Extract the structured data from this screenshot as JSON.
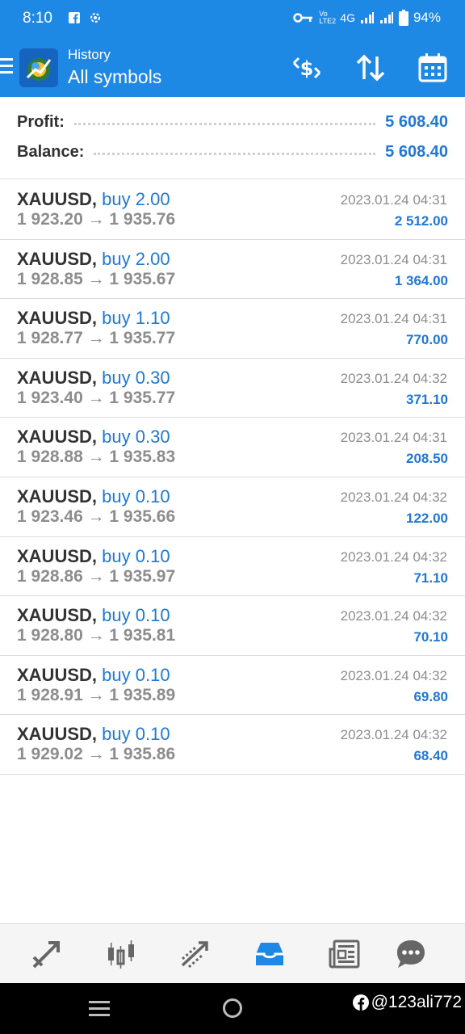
{
  "status_bar": {
    "time": "8:10",
    "network": "4G",
    "battery": "94%"
  },
  "app_bar": {
    "subtitle": "History",
    "title": "All symbols"
  },
  "summary": {
    "profit_label": "Profit:",
    "profit_value": "5 608.40",
    "balance_label": "Balance:",
    "balance_value": "5 608.40"
  },
  "deals": [
    {
      "symbol": "XAUUSD",
      "separator": ",",
      "side": "buy 2.00",
      "prices": "1 923.20 → 1 935.76",
      "date": "2023.01.24 04:31",
      "profit": "2 512.00"
    },
    {
      "symbol": "XAUUSD",
      "separator": ",",
      "side": "buy 2.00",
      "prices": "1 928.85 → 1 935.67",
      "date": "2023.01.24 04:31",
      "profit": "1 364.00"
    },
    {
      "symbol": "XAUUSD",
      "separator": ",",
      "side": "buy 1.10",
      "prices": "1 928.77 → 1 935.77",
      "date": "2023.01.24 04:31",
      "profit": "770.00"
    },
    {
      "symbol": "XAUUSD",
      "separator": ",",
      "side": "buy 0.30",
      "prices": "1 923.40 → 1 935.77",
      "date": "2023.01.24 04:32",
      "profit": "371.10"
    },
    {
      "symbol": "XAUUSD",
      "separator": ",",
      "side": "buy 0.30",
      "prices": "1 928.88 → 1 935.83",
      "date": "2023.01.24 04:31",
      "profit": "208.50"
    },
    {
      "symbol": "XAUUSD",
      "separator": ",",
      "side": "buy 0.10",
      "prices": "1 923.46 → 1 935.66",
      "date": "2023.01.24 04:32",
      "profit": "122.00"
    },
    {
      "symbol": "XAUUSD",
      "separator": ",",
      "side": "buy 0.10",
      "prices": "1 928.86 → 1 935.97",
      "date": "2023.01.24 04:32",
      "profit": "71.10"
    },
    {
      "symbol": "XAUUSD",
      "separator": ",",
      "side": "buy 0.10",
      "prices": "1 928.80 → 1 935.81",
      "date": "2023.01.24 04:32",
      "profit": "70.10"
    },
    {
      "symbol": "XAUUSD",
      "separator": ",",
      "side": "buy 0.10",
      "prices": "1 928.91 → 1 935.89",
      "date": "2023.01.24 04:32",
      "profit": "69.80"
    },
    {
      "symbol": "XAUUSD",
      "separator": ",",
      "side": "buy 0.10",
      "prices": "1 929.02 → 1 935.86",
      "date": "2023.01.24 04:32",
      "profit": "68.40"
    }
  ],
  "tabs": [
    {
      "icon": "quotes-icon",
      "active": false
    },
    {
      "icon": "chart-icon",
      "active": false
    },
    {
      "icon": "trade-icon",
      "active": false
    },
    {
      "icon": "history-icon",
      "active": true
    },
    {
      "icon": "news-icon",
      "active": false
    },
    {
      "icon": "chat-icon",
      "active": false
    }
  ],
  "watermark": "@123ali772",
  "colors": {
    "accent": "#1e88e5",
    "value_blue": "#1e78d6",
    "muted": "#8d8d8d"
  }
}
